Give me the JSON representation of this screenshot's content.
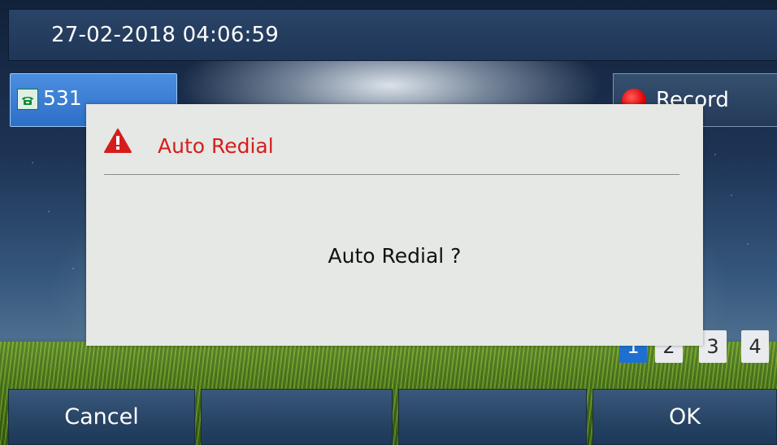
{
  "status_bar": {
    "datetime": "27-02-2018 04:06:59"
  },
  "line_key": {
    "label": "531",
    "icon": "phone-icon",
    "accent": "#2c6fc7"
  },
  "record_key": {
    "label": "Record",
    "icon": "record-icon",
    "dot_color": "#e00000"
  },
  "page_indicators": {
    "pages": [
      "1",
      "2",
      "3",
      "4"
    ],
    "active_page": "1"
  },
  "dialog": {
    "icon": "warning-icon",
    "title": "Auto Redial",
    "title_color": "#d61d1d",
    "message": "Auto Redial ?"
  },
  "softkeys": {
    "key1": "Cancel",
    "key2": "",
    "key3": "",
    "key4": "OK"
  }
}
